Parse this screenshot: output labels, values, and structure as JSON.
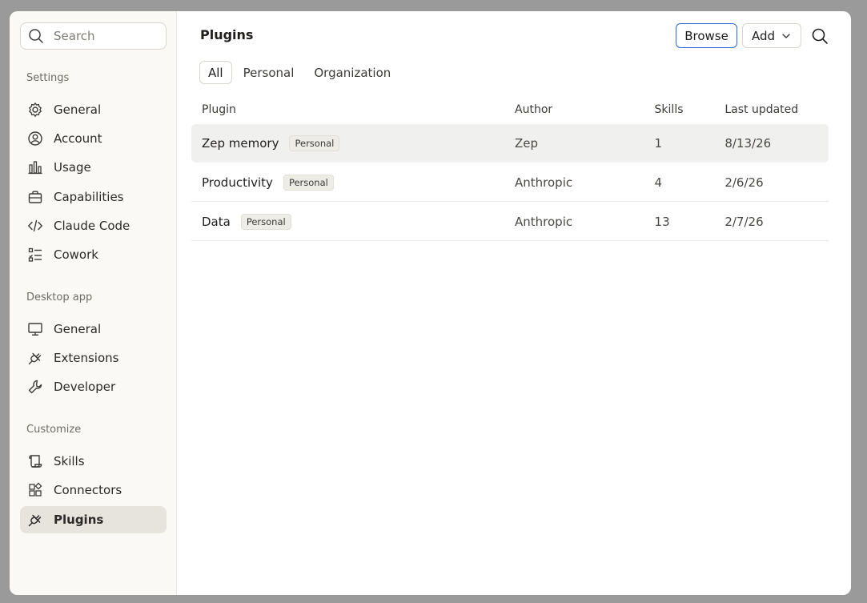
{
  "sidebar": {
    "search_placeholder": "Search",
    "sections": [
      {
        "label": "Settings",
        "items": [
          {
            "label": "General",
            "icon": "gear-icon"
          },
          {
            "label": "Account",
            "icon": "user-circle-icon"
          },
          {
            "label": "Usage",
            "icon": "bar-chart-icon"
          },
          {
            "label": "Capabilities",
            "icon": "briefcase-icon"
          },
          {
            "label": "Claude Code",
            "icon": "code-icon"
          },
          {
            "label": "Cowork",
            "icon": "checklist-icon"
          }
        ]
      },
      {
        "label": "Desktop app",
        "items": [
          {
            "label": "General",
            "icon": "monitor-icon"
          },
          {
            "label": "Extensions",
            "icon": "plug-icon"
          },
          {
            "label": "Developer",
            "icon": "wrench-icon"
          }
        ]
      },
      {
        "label": "Customize",
        "items": [
          {
            "label": "Skills",
            "icon": "scroll-icon"
          },
          {
            "label": "Connectors",
            "icon": "blocks-icon"
          },
          {
            "label": "Plugins",
            "icon": "plug-icon"
          }
        ]
      }
    ],
    "active_item": "Plugins"
  },
  "header": {
    "title": "Plugins",
    "browse_label": "Browse",
    "add_label": "Add"
  },
  "tabs": [
    {
      "label": "All",
      "active": true
    },
    {
      "label": "Personal",
      "active": false
    },
    {
      "label": "Organization",
      "active": false
    }
  ],
  "table": {
    "columns": [
      "Plugin",
      "Author",
      "Skills",
      "Last updated"
    ],
    "rows": [
      {
        "plugin": "Zep memory",
        "badge": "Personal",
        "author": "Zep",
        "skills": "1",
        "updated": "8/13/26"
      },
      {
        "plugin": "Productivity",
        "badge": "Personal",
        "author": "Anthropic",
        "skills": "4",
        "updated": "2/6/26"
      },
      {
        "plugin": "Data",
        "badge": "Personal",
        "author": "Anthropic",
        "skills": "13",
        "updated": "2/7/26"
      }
    ]
  },
  "colors": {
    "accent_border": "#2f6ad0",
    "sidebar_bg": "#faf9f5",
    "active_item_bg": "#e6e4dd",
    "hover_row_bg": "#f0f0ee"
  }
}
